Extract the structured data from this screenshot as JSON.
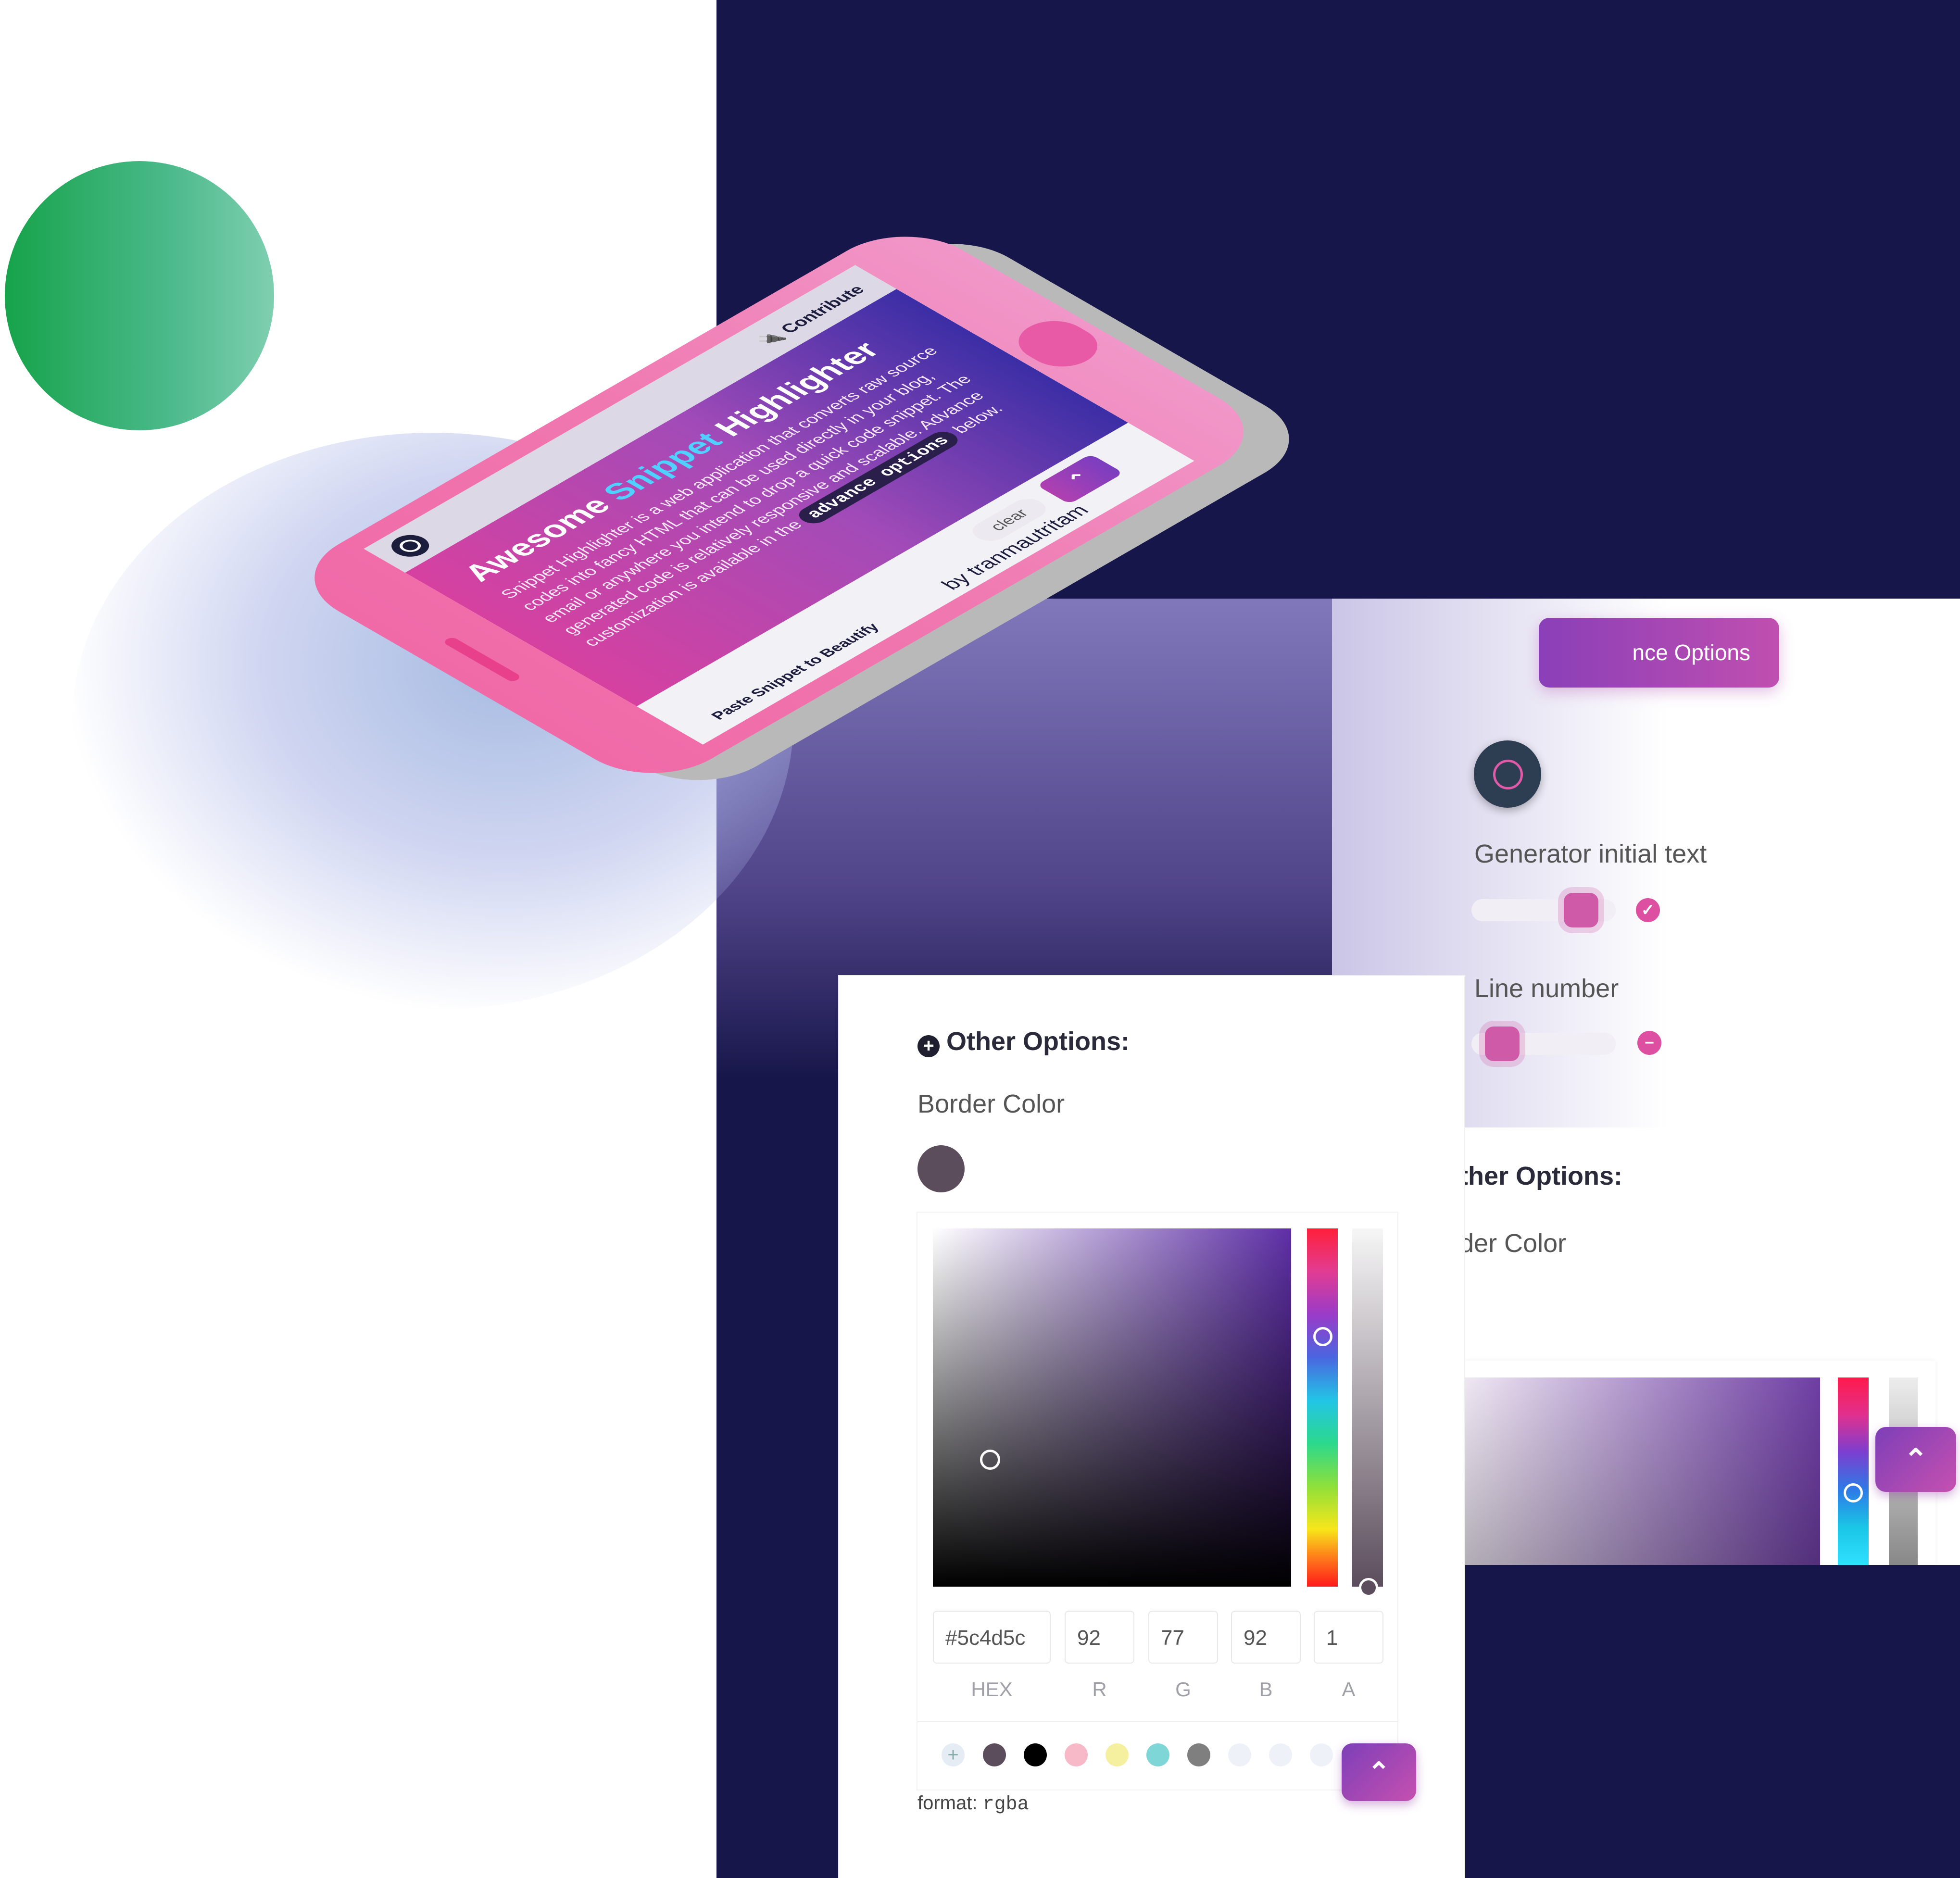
{
  "phone": {
    "contribute": "Contribute",
    "title_part1": "Awesome ",
    "title_accent": "Snippet",
    "title_part2": " Highlighter",
    "description_part1": "Snippet Highlighter is a web application that converts raw source codes into fancy HTML that can be used directly in your blog, email or anywhere you intend to drop a quick code snippet. The generated code is relatively responsive and scalable. Advance customization is available in the ",
    "description_code": "advance options",
    "description_part2": " below.",
    "clear_button": "clear",
    "collapse_button": "⌃",
    "paste_label": "Paste Snippet to Beautify",
    "credit": "by tranmautritam"
  },
  "settings": {
    "advance_button": "nce Options",
    "generator_label": "Generator initial text",
    "line_number_label": "Line number",
    "generator_status_icon": "✓",
    "line_number_status_icon": "−",
    "other_options_partial": "ther Options:",
    "border_color_partial": "der Color",
    "back_to_top": "⌃"
  },
  "picker": {
    "other_options": "Other Options:",
    "plus_icon": "+",
    "border_color_label": "Border Color",
    "hex_value": "#5c4d5c",
    "r_value": "92",
    "g_value": "77",
    "b_value": "92",
    "a_value": "1",
    "hex_caption": "HEX",
    "r_caption": "R",
    "g_caption": "G",
    "b_caption": "B",
    "a_caption": "A",
    "add_preset": "+",
    "format_label": "format: ",
    "format_value": "rgba",
    "back_to_top": "⌃"
  },
  "colors": {
    "navy": "#17164a",
    "pink": "#f06aa8",
    "selected": "#5c4d5c",
    "presets": [
      "#5c4d5c",
      "#000000",
      "#f7b8c8",
      "#f5f0a0",
      "#7fd6d6",
      "#7f7f7f",
      "#eef2f8",
      "#eef2f8",
      "#eef2f8"
    ]
  }
}
